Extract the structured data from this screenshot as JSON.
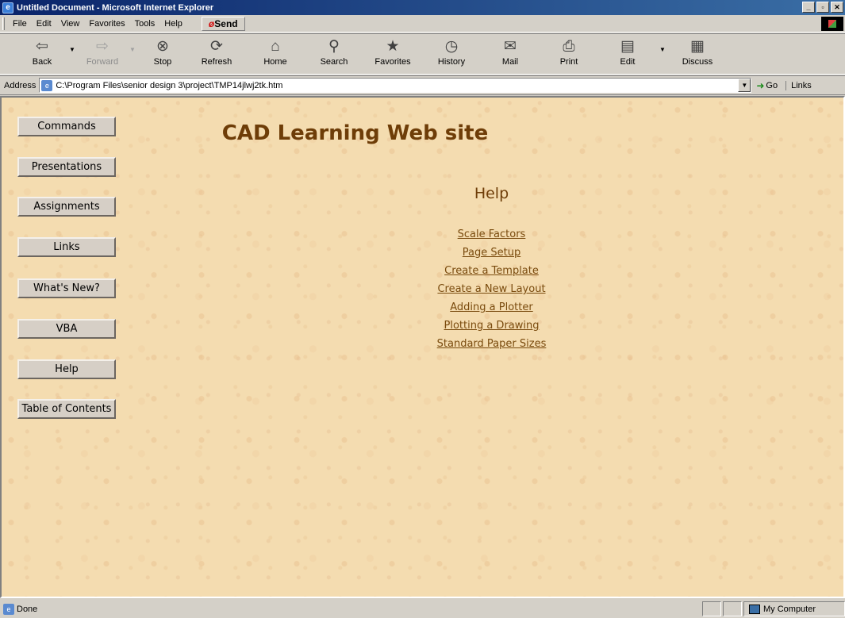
{
  "window": {
    "title": "Untitled Document - Microsoft Internet Explorer"
  },
  "menu": {
    "items": [
      "File",
      "Edit",
      "View",
      "Favorites",
      "Tools",
      "Help"
    ],
    "send_label": "Send"
  },
  "toolbar": {
    "back": "Back",
    "forward": "Forward",
    "stop": "Stop",
    "refresh": "Refresh",
    "home": "Home",
    "search": "Search",
    "favorites": "Favorites",
    "history": "History",
    "mail": "Mail",
    "print": "Print",
    "edit": "Edit",
    "discuss": "Discuss"
  },
  "address": {
    "label": "Address",
    "url": "C:\\Program Files\\senior design 3\\project\\TMP14jlwj2tk.htm",
    "go": "Go",
    "links": "Links"
  },
  "page": {
    "title": "CAD Learning Web site",
    "heading": "Help",
    "nav": [
      "Commands",
      "Presentations",
      "Assignments",
      "Links",
      "What's New?",
      "VBA",
      "Help",
      "Table of Contents"
    ],
    "help_links": [
      "Scale Factors",
      "Page Setup",
      "Create a Template",
      "Create a New Layout",
      "Adding a Plotter",
      "Plotting a Drawing",
      "Standard Paper Sizes"
    ]
  },
  "status": {
    "text": "Done",
    "zone": "My Computer"
  },
  "colors": {
    "titlebar": "#0a246a",
    "page_background": "#f4dcb0",
    "heading_text": "#6e3d08",
    "link_text": "#7a4b0e"
  }
}
